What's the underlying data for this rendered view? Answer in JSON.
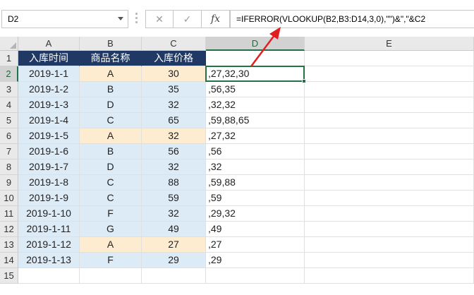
{
  "name_box": "D2",
  "formula_buttons": {
    "cancel": "✕",
    "enter": "✓",
    "fx": "fx"
  },
  "formula": "=IFERROR(VLOOKUP(B2,B3:D14,3,0),\"\")&\",\"&C2",
  "columns": [
    "A",
    "B",
    "C",
    "D",
    "E"
  ],
  "rows": [
    "1",
    "2",
    "3",
    "4",
    "5",
    "6",
    "7",
    "8",
    "9",
    "10",
    "11",
    "12",
    "13",
    "14",
    "15"
  ],
  "headers": [
    "入库时间",
    "商品名称",
    "入库价格"
  ],
  "data": [
    {
      "date": "2019-1-1",
      "product": "A",
      "price": "30",
      "result": ",27,32,30",
      "highlight": true
    },
    {
      "date": "2019-1-2",
      "product": "B",
      "price": "35",
      "result": ",56,35",
      "highlight": false
    },
    {
      "date": "2019-1-3",
      "product": "D",
      "price": "32",
      "result": ",32,32",
      "highlight": false
    },
    {
      "date": "2019-1-4",
      "product": "C",
      "price": "65",
      "result": ",59,88,65",
      "highlight": false
    },
    {
      "date": "2019-1-5",
      "product": "A",
      "price": "32",
      "result": ",27,32",
      "highlight": true
    },
    {
      "date": "2019-1-6",
      "product": "B",
      "price": "56",
      "result": ",56",
      "highlight": false
    },
    {
      "date": "2019-1-7",
      "product": "D",
      "price": "32",
      "result": ",32",
      "highlight": false
    },
    {
      "date": "2019-1-8",
      "product": "C",
      "price": "88",
      "result": ",59,88",
      "highlight": false
    },
    {
      "date": "2019-1-9",
      "product": "C",
      "price": "59",
      "result": ",59",
      "highlight": false
    },
    {
      "date": "2019-1-10",
      "product": "F",
      "price": "32",
      "result": ",29,32",
      "highlight": false
    },
    {
      "date": "2019-1-11",
      "product": "G",
      "price": "49",
      "result": ",49",
      "highlight": false
    },
    {
      "date": "2019-1-12",
      "product": "A",
      "price": "27",
      "result": ",27",
      "highlight": true
    },
    {
      "date": "2019-1-13",
      "product": "F",
      "price": "29",
      "result": ",29",
      "highlight": false
    }
  ],
  "colors": {
    "header_fill": "#1f3864",
    "data_fill": "#ddebf7",
    "highlight_fill": "#fdeccf",
    "selection": "#217346",
    "arrow": "#e02020"
  }
}
